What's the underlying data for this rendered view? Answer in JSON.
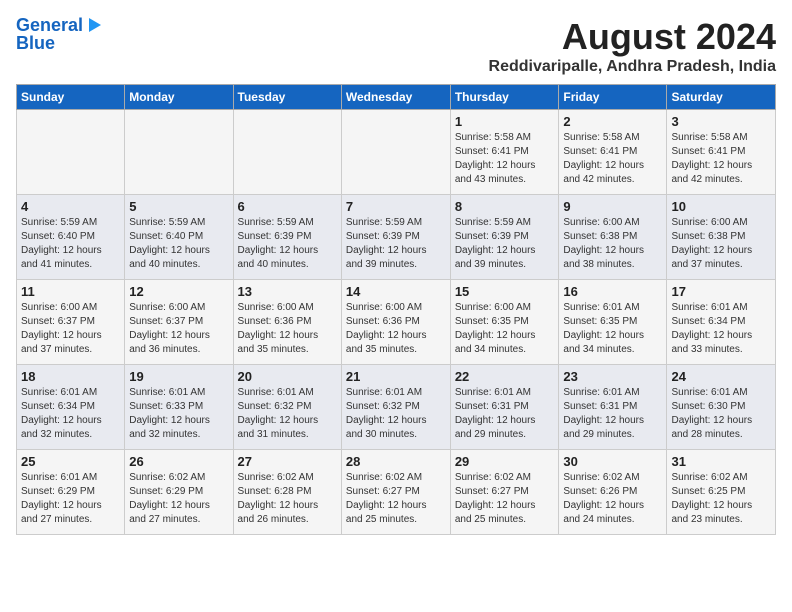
{
  "header": {
    "logo_line1": "General",
    "logo_line2": "Blue",
    "title": "August 2024",
    "subtitle": "Reddivaripalle, Andhra Pradesh, India"
  },
  "columns": [
    "Sunday",
    "Monday",
    "Tuesday",
    "Wednesday",
    "Thursday",
    "Friday",
    "Saturday"
  ],
  "weeks": [
    [
      {
        "day": "",
        "info": ""
      },
      {
        "day": "",
        "info": ""
      },
      {
        "day": "",
        "info": ""
      },
      {
        "day": "",
        "info": ""
      },
      {
        "day": "1",
        "info": "Sunrise: 5:58 AM\nSunset: 6:41 PM\nDaylight: 12 hours\nand 43 minutes."
      },
      {
        "day": "2",
        "info": "Sunrise: 5:58 AM\nSunset: 6:41 PM\nDaylight: 12 hours\nand 42 minutes."
      },
      {
        "day": "3",
        "info": "Sunrise: 5:58 AM\nSunset: 6:41 PM\nDaylight: 12 hours\nand 42 minutes."
      }
    ],
    [
      {
        "day": "4",
        "info": "Sunrise: 5:59 AM\nSunset: 6:40 PM\nDaylight: 12 hours\nand 41 minutes."
      },
      {
        "day": "5",
        "info": "Sunrise: 5:59 AM\nSunset: 6:40 PM\nDaylight: 12 hours\nand 40 minutes."
      },
      {
        "day": "6",
        "info": "Sunrise: 5:59 AM\nSunset: 6:39 PM\nDaylight: 12 hours\nand 40 minutes."
      },
      {
        "day": "7",
        "info": "Sunrise: 5:59 AM\nSunset: 6:39 PM\nDaylight: 12 hours\nand 39 minutes."
      },
      {
        "day": "8",
        "info": "Sunrise: 5:59 AM\nSunset: 6:39 PM\nDaylight: 12 hours\nand 39 minutes."
      },
      {
        "day": "9",
        "info": "Sunrise: 6:00 AM\nSunset: 6:38 PM\nDaylight: 12 hours\nand 38 minutes."
      },
      {
        "day": "10",
        "info": "Sunrise: 6:00 AM\nSunset: 6:38 PM\nDaylight: 12 hours\nand 37 minutes."
      }
    ],
    [
      {
        "day": "11",
        "info": "Sunrise: 6:00 AM\nSunset: 6:37 PM\nDaylight: 12 hours\nand 37 minutes."
      },
      {
        "day": "12",
        "info": "Sunrise: 6:00 AM\nSunset: 6:37 PM\nDaylight: 12 hours\nand 36 minutes."
      },
      {
        "day": "13",
        "info": "Sunrise: 6:00 AM\nSunset: 6:36 PM\nDaylight: 12 hours\nand 35 minutes."
      },
      {
        "day": "14",
        "info": "Sunrise: 6:00 AM\nSunset: 6:36 PM\nDaylight: 12 hours\nand 35 minutes."
      },
      {
        "day": "15",
        "info": "Sunrise: 6:00 AM\nSunset: 6:35 PM\nDaylight: 12 hours\nand 34 minutes."
      },
      {
        "day": "16",
        "info": "Sunrise: 6:01 AM\nSunset: 6:35 PM\nDaylight: 12 hours\nand 34 minutes."
      },
      {
        "day": "17",
        "info": "Sunrise: 6:01 AM\nSunset: 6:34 PM\nDaylight: 12 hours\nand 33 minutes."
      }
    ],
    [
      {
        "day": "18",
        "info": "Sunrise: 6:01 AM\nSunset: 6:34 PM\nDaylight: 12 hours\nand 32 minutes."
      },
      {
        "day": "19",
        "info": "Sunrise: 6:01 AM\nSunset: 6:33 PM\nDaylight: 12 hours\nand 32 minutes."
      },
      {
        "day": "20",
        "info": "Sunrise: 6:01 AM\nSunset: 6:32 PM\nDaylight: 12 hours\nand 31 minutes."
      },
      {
        "day": "21",
        "info": "Sunrise: 6:01 AM\nSunset: 6:32 PM\nDaylight: 12 hours\nand 30 minutes."
      },
      {
        "day": "22",
        "info": "Sunrise: 6:01 AM\nSunset: 6:31 PM\nDaylight: 12 hours\nand 29 minutes."
      },
      {
        "day": "23",
        "info": "Sunrise: 6:01 AM\nSunset: 6:31 PM\nDaylight: 12 hours\nand 29 minutes."
      },
      {
        "day": "24",
        "info": "Sunrise: 6:01 AM\nSunset: 6:30 PM\nDaylight: 12 hours\nand 28 minutes."
      }
    ],
    [
      {
        "day": "25",
        "info": "Sunrise: 6:01 AM\nSunset: 6:29 PM\nDaylight: 12 hours\nand 27 minutes."
      },
      {
        "day": "26",
        "info": "Sunrise: 6:02 AM\nSunset: 6:29 PM\nDaylight: 12 hours\nand 27 minutes."
      },
      {
        "day": "27",
        "info": "Sunrise: 6:02 AM\nSunset: 6:28 PM\nDaylight: 12 hours\nand 26 minutes."
      },
      {
        "day": "28",
        "info": "Sunrise: 6:02 AM\nSunset: 6:27 PM\nDaylight: 12 hours\nand 25 minutes."
      },
      {
        "day": "29",
        "info": "Sunrise: 6:02 AM\nSunset: 6:27 PM\nDaylight: 12 hours\nand 25 minutes."
      },
      {
        "day": "30",
        "info": "Sunrise: 6:02 AM\nSunset: 6:26 PM\nDaylight: 12 hours\nand 24 minutes."
      },
      {
        "day": "31",
        "info": "Sunrise: 6:02 AM\nSunset: 6:25 PM\nDaylight: 12 hours\nand 23 minutes."
      }
    ]
  ]
}
